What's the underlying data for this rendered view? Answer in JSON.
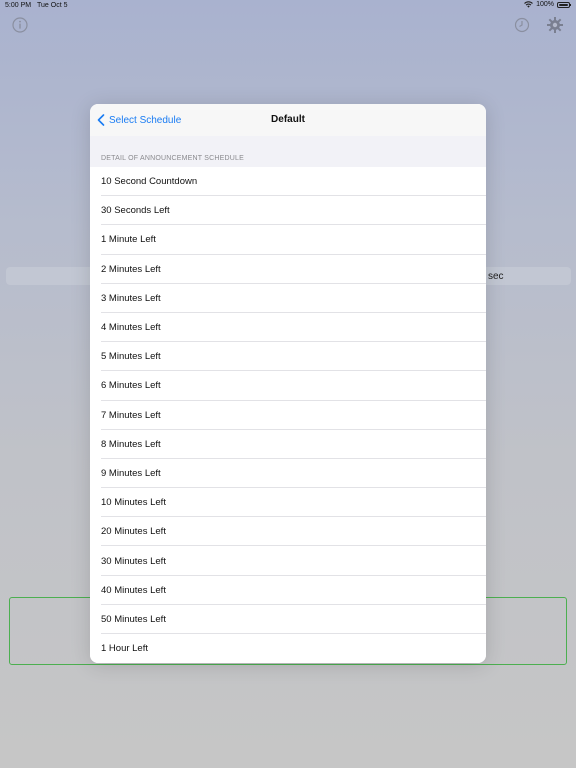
{
  "status_bar": {
    "time": "5:00 PM",
    "date": "Tue Oct 5",
    "battery": "100%"
  },
  "background": {
    "sec_label": "sec"
  },
  "modal": {
    "back_label": "Select Schedule",
    "title": "Default",
    "section_header": "DETAIL OF ANNOUNCEMENT SCHEDULE",
    "items": [
      {
        "label": "10 Second Countdown"
      },
      {
        "label": "30 Seconds Left"
      },
      {
        "label": "1 Minute Left"
      },
      {
        "label": "2 Minutes Left"
      },
      {
        "label": "3 Minutes Left"
      },
      {
        "label": "4 Minutes Left"
      },
      {
        "label": "5 Minutes Left"
      },
      {
        "label": "6 Minutes Left"
      },
      {
        "label": "7 Minutes Left"
      },
      {
        "label": "8 Minutes Left"
      },
      {
        "label": "9 Minutes Left"
      },
      {
        "label": "10 Minutes Left"
      },
      {
        "label": "20 Minutes Left"
      },
      {
        "label": "30 Minutes Left"
      },
      {
        "label": "40 Minutes Left"
      },
      {
        "label": "50 Minutes Left"
      },
      {
        "label": "1 Hour Left"
      }
    ]
  },
  "colors": {
    "accent": "#1a7cf3",
    "green_border": "#4caf50"
  },
  "icons": {
    "info": "info-icon",
    "history": "clock-icon",
    "settings": "gear-icon",
    "back": "chevron-left-icon",
    "wifi": "wifi-icon",
    "battery": "battery-icon"
  }
}
